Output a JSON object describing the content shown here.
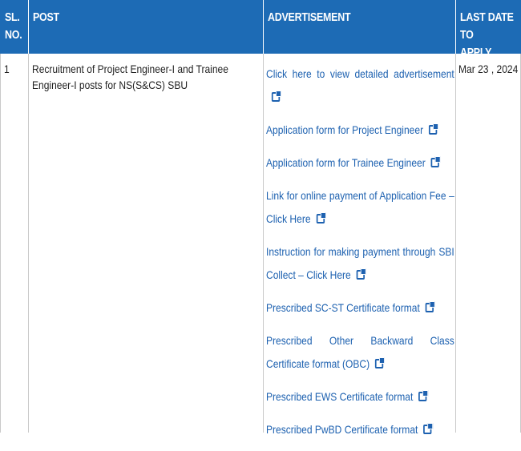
{
  "table": {
    "headers": {
      "sl_no": "SL.\nNO.",
      "post": "POST",
      "advertisement": "ADVERTISEMENT",
      "last_date": "LAST DATE TO\nAPPLY"
    },
    "row": {
      "sl_no": "1",
      "post": "Recruitment of Project Engineer-I and Trainee Engineer-I posts for NS(S&CS) SBU",
      "last_date": "Mar 23 , 2024",
      "links": [
        {
          "label": "Click here to view detailed advertisement",
          "icon": "external-link-icon"
        },
        {
          "label": "Application form for Project Engineer",
          "icon": "external-link-icon"
        },
        {
          "label": "Application form for Trainee Engineer",
          "icon": "external-link-icon"
        },
        {
          "label": "Link for online payment of Application Fee – Click Here",
          "icon": "external-link-icon"
        },
        {
          "label": "Instruction for making payment through SBI Collect – Click Here",
          "icon": "external-link-icon"
        },
        {
          "label": "Prescribed SC-ST Certificate format",
          "icon": "external-link-icon"
        },
        {
          "label": "Prescribed Other Backward Class Certificate format (OBC)",
          "icon": "external-link-icon"
        },
        {
          "label": "Prescribed EWS Certificate format",
          "icon": "external-link-icon"
        },
        {
          "label": "Prescribed PwBD Certificate format",
          "icon": "external-link-icon"
        }
      ]
    }
  },
  "colors": {
    "header_bg": "#1d6bb5",
    "link": "#1d61b0",
    "border": "#c9c9c9"
  }
}
